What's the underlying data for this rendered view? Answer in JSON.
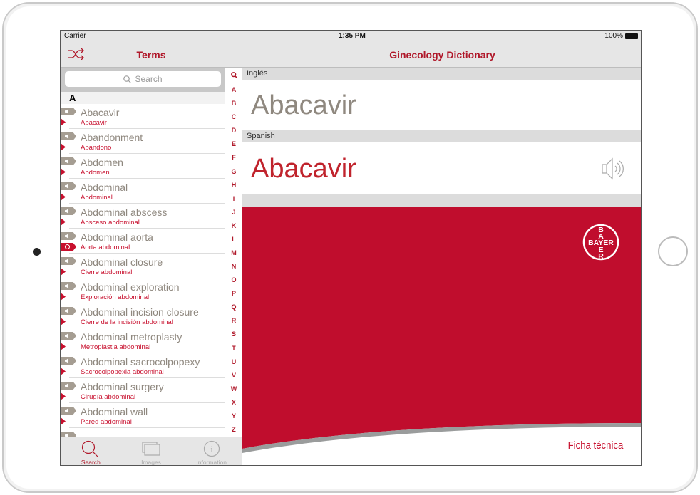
{
  "status_bar": {
    "carrier": "Carrier",
    "time": "1:35 PM",
    "battery": "100%"
  },
  "sidebar": {
    "title": "Terms",
    "search_placeholder": "Search",
    "section": "A",
    "index": [
      "A",
      "B",
      "C",
      "D",
      "E",
      "F",
      "G",
      "H",
      "I",
      "J",
      "K",
      "L",
      "M",
      "N",
      "O",
      "P",
      "Q",
      "R",
      "S",
      "T",
      "U",
      "V",
      "W",
      "X",
      "Y",
      "Z"
    ],
    "terms": [
      {
        "en": "Abacavir",
        "es": "Abacavir",
        "badge": "flag"
      },
      {
        "en": "Abandonment",
        "es": "Abandono",
        "badge": "flag"
      },
      {
        "en": "Abdomen",
        "es": "Abdomen",
        "badge": "flag"
      },
      {
        "en": "Abdominal",
        "es": "Abdominal",
        "badge": "flag"
      },
      {
        "en": "Abdominal abscess",
        "es": "Absceso abdominal",
        "badge": "flag"
      },
      {
        "en": "Abdominal aorta",
        "es": "Aorta abdominal",
        "badge": "camera"
      },
      {
        "en": "Abdominal closure",
        "es": "Cierre abdominal",
        "badge": "flag"
      },
      {
        "en": "Abdominal exploration",
        "es": "Exploración abdominal",
        "badge": "flag"
      },
      {
        "en": "Abdominal incision closure",
        "es": "Cierre de la incisión abdominal",
        "badge": "flag"
      },
      {
        "en": "Abdominal metroplasty",
        "es": "Metroplastia abdominal",
        "badge": "flag"
      },
      {
        "en": "Abdominal sacrocolpopexy",
        "es": "Sacrocolpopexia abdominal",
        "badge": "flag"
      },
      {
        "en": "Abdominal surgery",
        "es": "Cirugía abdominal",
        "badge": "flag"
      },
      {
        "en": "Abdominal wall",
        "es": "Pared abdominal",
        "badge": "flag"
      }
    ]
  },
  "tabs": [
    {
      "label": "Search",
      "icon": "search-icon",
      "active": true
    },
    {
      "label": "Images",
      "icon": "images-icon"
    },
    {
      "label": "Information",
      "icon": "info-icon"
    }
  ],
  "main": {
    "title": "Ginecology Dictionary",
    "english_label": "Inglés",
    "english_term": "Abacavir",
    "spanish_label": "Spanish",
    "spanish_term": "Abacavir",
    "logo": "BAYER",
    "link": "Ficha técnica"
  },
  "colors": {
    "accent": "#b0182a",
    "brand_red": "#c00d2d",
    "english_term": "#8f887f",
    "spanish_term": "#c0232c"
  }
}
